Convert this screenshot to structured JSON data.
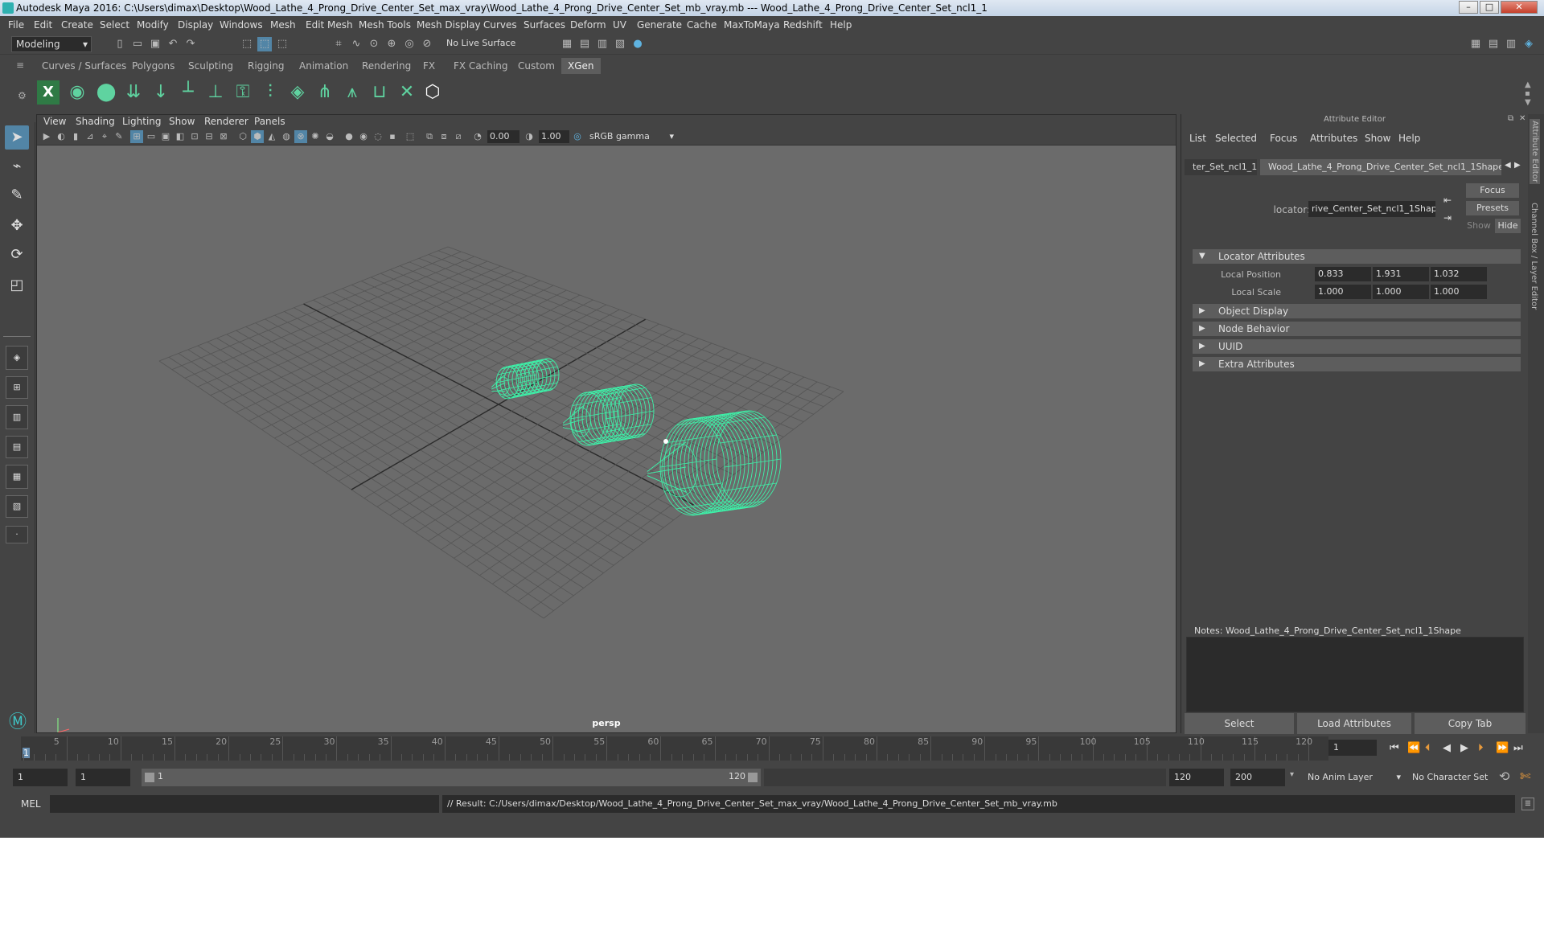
{
  "window": {
    "title": "Autodesk Maya 2016: C:\\Users\\dimax\\Desktop\\Wood_Lathe_4_Prong_Drive_Center_Set_max_vray\\Wood_Lathe_4_Prong_Drive_Center_Set_mb_vray.mb  ---  Wood_Lathe_4_Prong_Drive_Center_Set_ncl1_1",
    "minimize": "–",
    "maximize": "□",
    "close": "✕"
  },
  "menu": [
    "File",
    "Edit",
    "Create",
    "Select",
    "Modify",
    "Display",
    "Windows",
    "Mesh",
    "Edit Mesh",
    "Mesh Tools",
    "Mesh Display",
    "Curves",
    "Surfaces",
    "Deform",
    "UV",
    "Generate",
    "Cache",
    "MaxToMaya",
    "Redshift",
    "Help"
  ],
  "status": {
    "mode": "Modeling",
    "live_surface": "No Live Surface"
  },
  "shelf": {
    "tabs": [
      "Curves / Surfaces",
      "Polygons",
      "Sculpting",
      "Rigging",
      "Animation",
      "Rendering",
      "FX",
      "FX Caching",
      "Custom",
      "XGen"
    ],
    "active_tab": "XGen"
  },
  "viewport": {
    "menu": [
      "View",
      "Shading",
      "Lighting",
      "Show",
      "Renderer",
      "Panels"
    ],
    "exposure": "0.00",
    "gamma": "1.00",
    "colorspace": "sRGB gamma",
    "camera_label": "persp",
    "wire_color": "#3ef0a8"
  },
  "attribute_editor": {
    "title": "Attribute Editor",
    "menu": [
      "List",
      "Selected",
      "Focus",
      "Attributes",
      "Show",
      "Help"
    ],
    "tab_left": "ter_Set_ncl1_1",
    "tab_active": "Wood_Lathe_4_Prong_Drive_Center_Set_ncl1_1Shape",
    "locator_label": "locator:",
    "locator_value": "rive_Center_Set_ncl1_1Shape",
    "focus_btn": "Focus",
    "presets_btn": "Presets",
    "show_btn": "Show",
    "hide_btn": "Hide",
    "sections": {
      "locator": "Locator Attributes",
      "object_display": "Object Display",
      "node_behavior": "Node Behavior",
      "uuid": "UUID",
      "extra": "Extra Attributes"
    },
    "local_position": {
      "label": "Local Position",
      "x": "0.833",
      "y": "1.931",
      "z": "1.032"
    },
    "local_scale": {
      "label": "Local Scale",
      "x": "1.000",
      "y": "1.000",
      "z": "1.000"
    },
    "notes": "Notes:  Wood_Lathe_4_Prong_Drive_Center_Set_ncl1_1Shape",
    "select_btn": "Select",
    "load_btn": "Load Attributes",
    "copy_btn": "Copy Tab",
    "side_tab_1": "Attribute Editor",
    "side_tab_2": "Channel Box / Layer Editor"
  },
  "timeline": {
    "labels": [
      "5",
      "10",
      "15",
      "20",
      "25",
      "30",
      "35",
      "40",
      "45",
      "50",
      "55",
      "60",
      "65",
      "70",
      "75",
      "80",
      "85",
      "90",
      "95",
      "100",
      "105",
      "110",
      "115",
      "120"
    ],
    "current_frame_marker": "1",
    "current_frame": "1"
  },
  "range": {
    "start": "1",
    "playback_start": "1",
    "range_start_value": "1",
    "range_end_value": "120",
    "playback_end": "120",
    "end": "200",
    "anim_layer": "No Anim Layer",
    "character_set": "No Character Set"
  },
  "command": {
    "lang": "MEL",
    "result": "// Result: C:/Users/dimax/Desktop/Wood_Lathe_4_Prong_Drive_Center_Set_max_vray/Wood_Lathe_4_Prong_Drive_Center_Set_mb_vray.mb"
  }
}
